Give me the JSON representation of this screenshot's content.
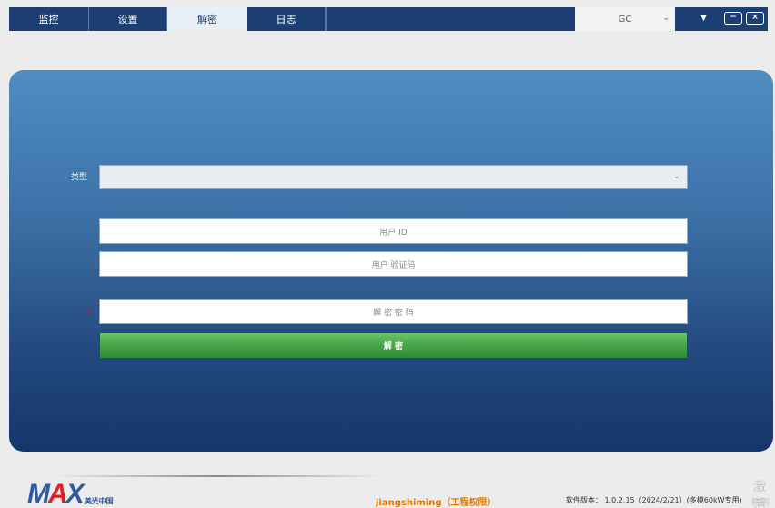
{
  "nav": {
    "tabs": [
      {
        "label": "监控"
      },
      {
        "label": "设置"
      },
      {
        "label": "解密"
      },
      {
        "label": "日志"
      }
    ],
    "active_tab": "解密",
    "device": {
      "value": "GC",
      "chevron": "⌄"
    },
    "menu_arrow": "▼",
    "minimize": "−",
    "close": "×"
  },
  "form": {
    "type_label": "类型",
    "type_value": "",
    "type_chevron": "⌄",
    "user_id_placeholder": "用户 ID",
    "verify_code_placeholder": "用户 验证码",
    "required_mark": "*",
    "decrypt_password_placeholder": "解 密 密 码",
    "decrypt_button": "解 密"
  },
  "footer": {
    "logo_main_1": "M",
    "logo_main_2": "A",
    "logo_main_x": "X",
    "logo_sub": "美光中国",
    "user": "jiangshiming（工程权限）",
    "version": "软件版本： 1.0.2.15（2024/2/21）(多模60kW专用)",
    "watermark_line1": "激活",
    "watermark_line2": "转到"
  },
  "colors": {
    "nav_bg": "#1c3f73",
    "panel_top": "#4f8dc2",
    "panel_bottom": "#15366a",
    "button_green": "#4aa74a",
    "user_text": "#e07a00"
  }
}
